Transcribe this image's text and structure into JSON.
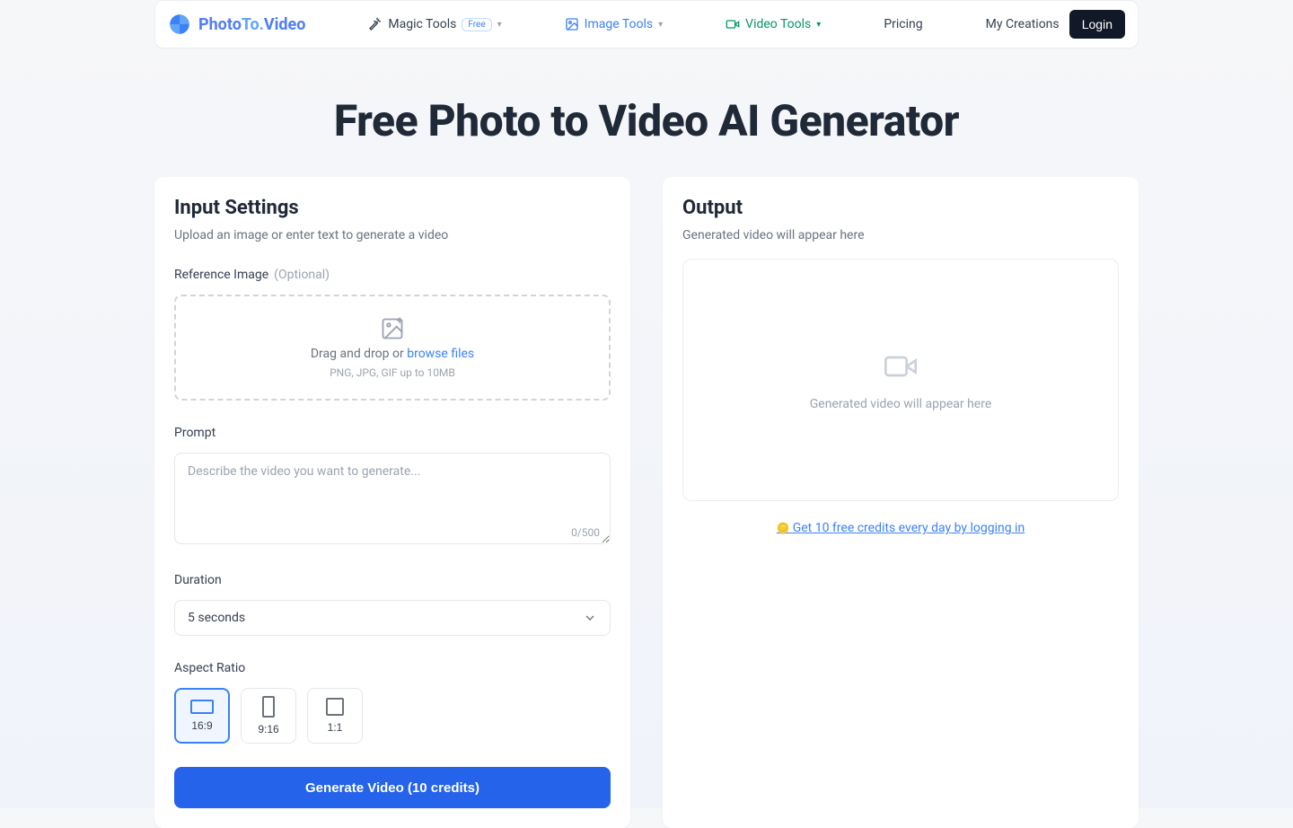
{
  "nav": {
    "logo_parts": {
      "a": "Photo",
      "b": "To.",
      "c": "Video"
    },
    "items": {
      "magic": {
        "label": "Magic Tools",
        "badge": "Free"
      },
      "image": {
        "label": "Image Tools"
      },
      "video": {
        "label": "Video Tools"
      },
      "pricing": {
        "label": "Pricing"
      },
      "mycreations": {
        "label": "My Creations"
      }
    },
    "login": "Login"
  },
  "hero": {
    "title": "Free Photo to Video AI Generator"
  },
  "input": {
    "heading": "Input Settings",
    "subtitle": "Upload an image or enter text to generate a video",
    "ref_label": "Reference Image",
    "ref_optional": "(Optional)",
    "drop_text_a": "Drag and drop or ",
    "drop_text_b": "browse files",
    "drop_hint": "PNG, JPG, GIF up to 10MB",
    "prompt_label": "Prompt",
    "prompt_placeholder": "Describe the video you want to generate...",
    "prompt_counter": "0/500",
    "duration_label": "Duration",
    "duration_value": "5 seconds",
    "aspect_label": "Aspect Ratio",
    "aspects": {
      "wide": "16:9",
      "tall": "9:16",
      "square": "1:1"
    },
    "generate": "Generate Video (10 credits)"
  },
  "output": {
    "heading": "Output",
    "subtitle": "Generated video will appear here",
    "placeholder": "Generated video will appear here",
    "credit_link": "Get 10 free credits every day by logging in"
  }
}
